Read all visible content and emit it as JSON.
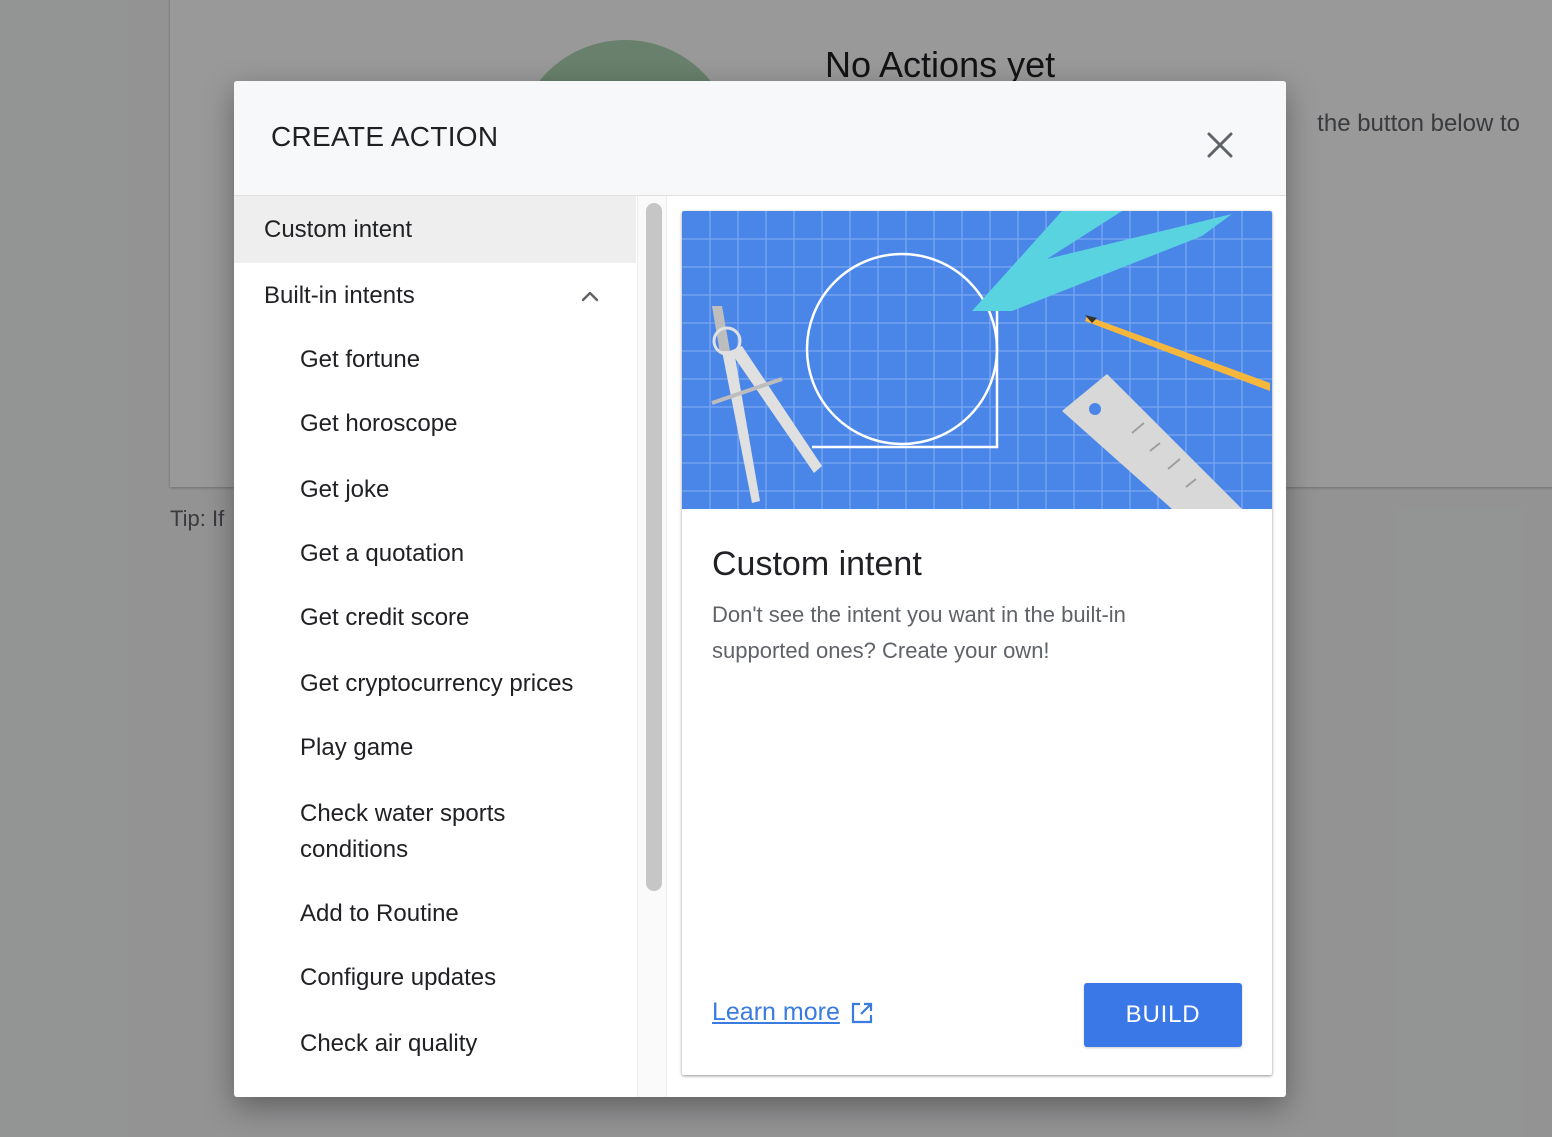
{
  "background": {
    "empty_title": "No Actions yet",
    "empty_desc_fragment": "the button below to",
    "tip_fragment": "Tip: If"
  },
  "dialog": {
    "title": "CREATE ACTION",
    "close_icon": "close-icon"
  },
  "intent_list": {
    "custom": "Custom intent",
    "builtin_header": "Built-in intents",
    "builtin_expanded": true,
    "items": [
      "Get fortune",
      "Get horoscope",
      "Get joke",
      "Get a quotation",
      "Get credit score",
      "Get cryptocurrency prices",
      "Play game",
      "Check water sports conditions",
      "Add to Routine",
      "Configure updates",
      "Check air quality"
    ]
  },
  "preview": {
    "title": "Custom intent",
    "description": "Don't see the intent you want in the built-in supported ones? Create your own!",
    "learn_more": "Learn more",
    "build": "BUILD"
  },
  "colors": {
    "accent": "#3b78e7",
    "blueprint": "#4a86e8",
    "link": "#3a7be0"
  }
}
